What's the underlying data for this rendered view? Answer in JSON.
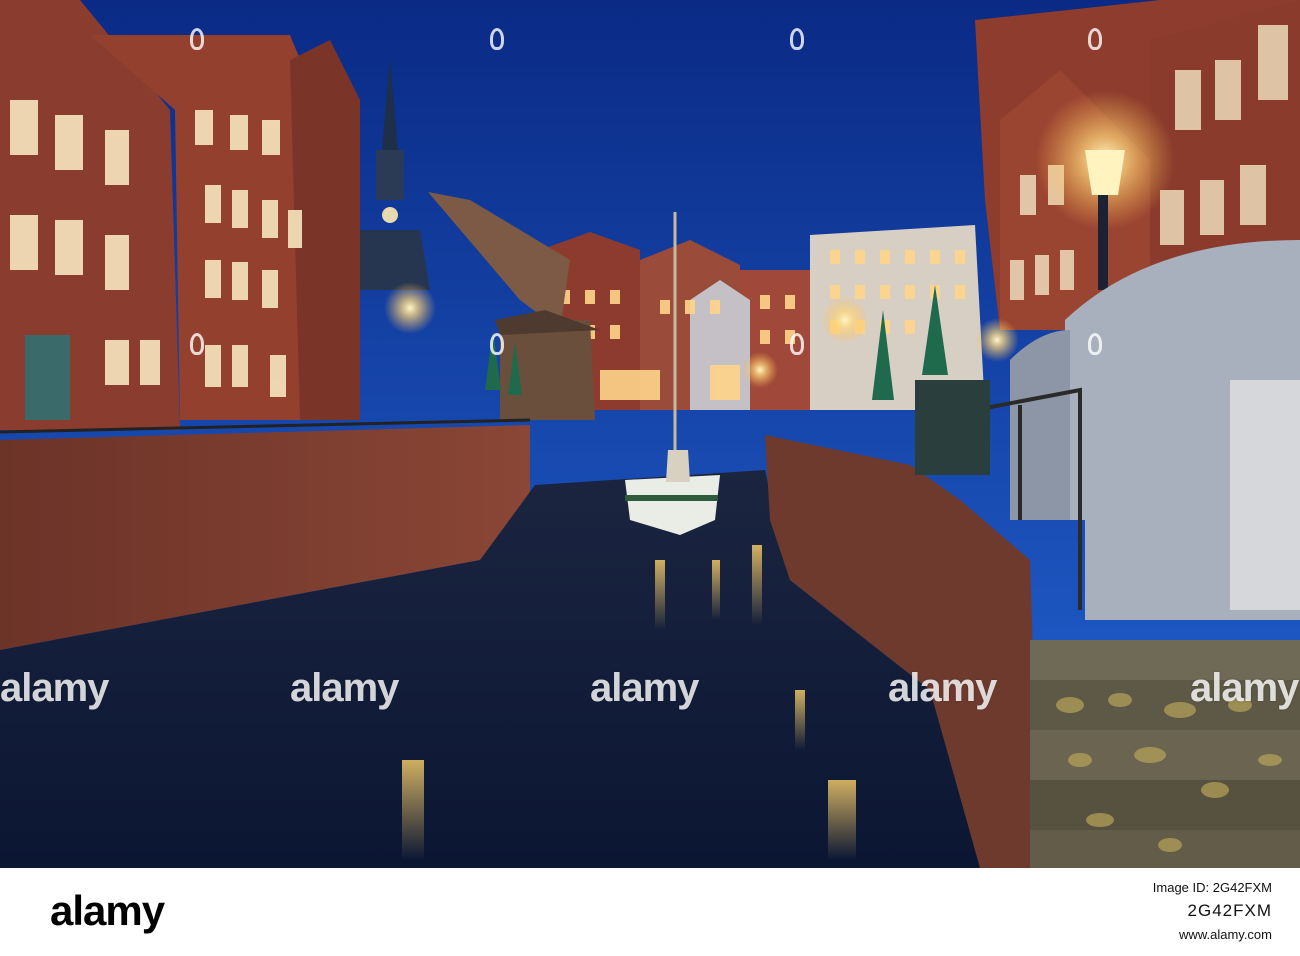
{
  "photo": {
    "description_icon": "canal-night-scene-image",
    "colors": {
      "sky_top": "#0b2b86",
      "sky_bottom": "#1f5cd0",
      "water": "#0a1a45",
      "brick": "#7a3a2c",
      "lamp_glow": "#ffd77a"
    }
  },
  "watermark": {
    "text": "alamy"
  },
  "footer": {
    "logo": "alamy",
    "id_label": "Image ID: 2G42FXM",
    "id_value": "2G42FXM",
    "url": "www.alamy.com"
  }
}
